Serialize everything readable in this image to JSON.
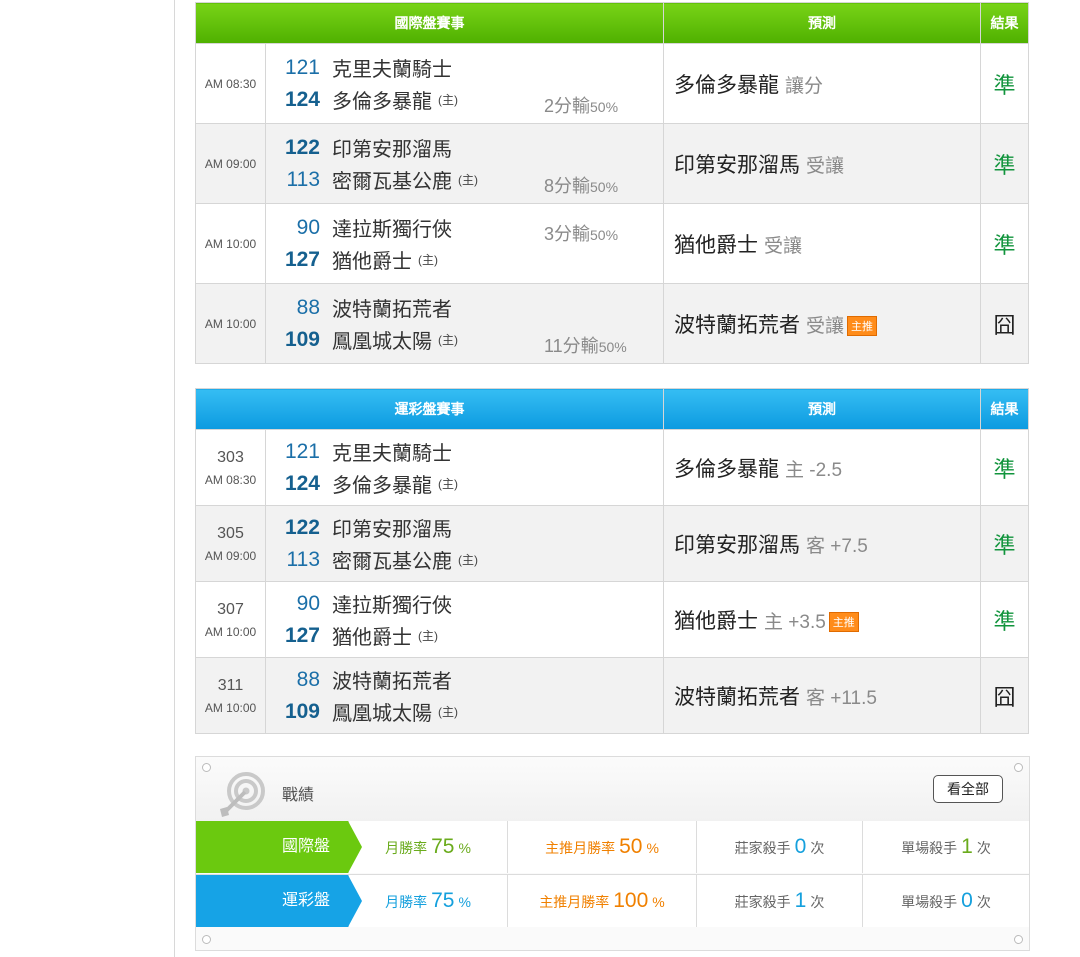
{
  "intl": {
    "header": {
      "games": "國際盤賽事",
      "prediction": "預測",
      "result": "結果"
    },
    "rows": [
      {
        "time": "AM 08:30",
        "away_num": "121",
        "away_name": "克里夫蘭騎士",
        "home_num": "124",
        "home_name": "多倫多暴龍",
        "home_mark": "(主)",
        "handicap": "2分輸",
        "handicap_pct": "50%",
        "pick": "多倫多暴龍",
        "pick_sub": "讓分",
        "pick_tag": "",
        "result": "準"
      },
      {
        "time": "AM 09:00",
        "away_num": "122",
        "away_name": "印第安那溜馬",
        "home_num": "113",
        "home_name": "密爾瓦基公鹿",
        "home_mark": "(主)",
        "handicap": "8分輸",
        "handicap_pct": "50%",
        "pick": "印第安那溜馬",
        "pick_sub": "受讓",
        "pick_tag": "",
        "result": "準"
      },
      {
        "time": "AM 10:00",
        "away_num": "90",
        "away_name": "達拉斯獨行俠",
        "home_num": "127",
        "home_name": "猶他爵士",
        "home_mark": "(主)",
        "handicap": "3分輸",
        "handicap_pct": "50%",
        "pick": "猶他爵士",
        "pick_sub": "受讓",
        "pick_tag": "",
        "result": "準"
      },
      {
        "time": "AM 10:00",
        "away_num": "88",
        "away_name": "波特蘭拓荒者",
        "home_num": "109",
        "home_name": "鳳凰城太陽",
        "home_mark": "(主)",
        "handicap": "11分輸",
        "handicap_pct": "50%",
        "pick": "波特蘭拓荒者",
        "pick_sub": "受讓",
        "pick_tag": "主推",
        "result": "囧"
      }
    ]
  },
  "lottery": {
    "header": {
      "games": "運彩盤賽事",
      "prediction": "預測",
      "result": "結果"
    },
    "rows": [
      {
        "game_no": "303",
        "time": "AM 08:30",
        "away_num": "121",
        "away_name": "克里夫蘭騎士",
        "home_num": "124",
        "home_name": "多倫多暴龍",
        "home_mark": "(主)",
        "pick": "多倫多暴龍",
        "pick_sub": "主 -2.5",
        "pick_tag": "",
        "result": "準"
      },
      {
        "game_no": "305",
        "time": "AM 09:00",
        "away_num": "122",
        "away_name": "印第安那溜馬",
        "home_num": "113",
        "home_name": "密爾瓦基公鹿",
        "home_mark": "(主)",
        "pick": "印第安那溜馬",
        "pick_sub": "客 +7.5",
        "pick_tag": "",
        "result": "準"
      },
      {
        "game_no": "307",
        "time": "AM 10:00",
        "away_num": "90",
        "away_name": "達拉斯獨行俠",
        "home_num": "127",
        "home_name": "猶他爵士",
        "home_mark": "(主)",
        "pick": "猶他爵士",
        "pick_sub": "主 +3.5",
        "pick_tag": "主推",
        "result": "準"
      },
      {
        "game_no": "311",
        "time": "AM 10:00",
        "away_num": "88",
        "away_name": "波特蘭拓荒者",
        "home_num": "109",
        "home_name": "鳳凰城太陽",
        "home_mark": "(主)",
        "pick": "波特蘭拓荒者",
        "pick_sub": "客 +11.5",
        "pick_tag": "",
        "result": "囧"
      }
    ]
  },
  "record": {
    "title": "戰績",
    "view_all": "看全部",
    "rows": [
      {
        "label": "國際盤",
        "monthly_label": "月勝率",
        "monthly_value": "75",
        "featured_label": "主推月勝率",
        "featured_value": "50",
        "pct": "%",
        "dealer_label": "莊家殺手",
        "dealer_value": "0",
        "single_label": "單場殺手",
        "single_value": "1",
        "times": "次"
      },
      {
        "label": "運彩盤",
        "monthly_label": "月勝率",
        "monthly_value": "75",
        "featured_label": "主推月勝率",
        "featured_value": "100",
        "pct": "%",
        "dealer_label": "莊家殺手",
        "dealer_value": "1",
        "single_label": "單場殺手",
        "single_value": "0",
        "times": "次"
      }
    ]
  },
  "colors": {
    "intl_green": "#5cbf0a",
    "lottery_blue": "#16a3e6",
    "result_ok": "#11943c",
    "featured_orange": "#ff8c1a"
  }
}
